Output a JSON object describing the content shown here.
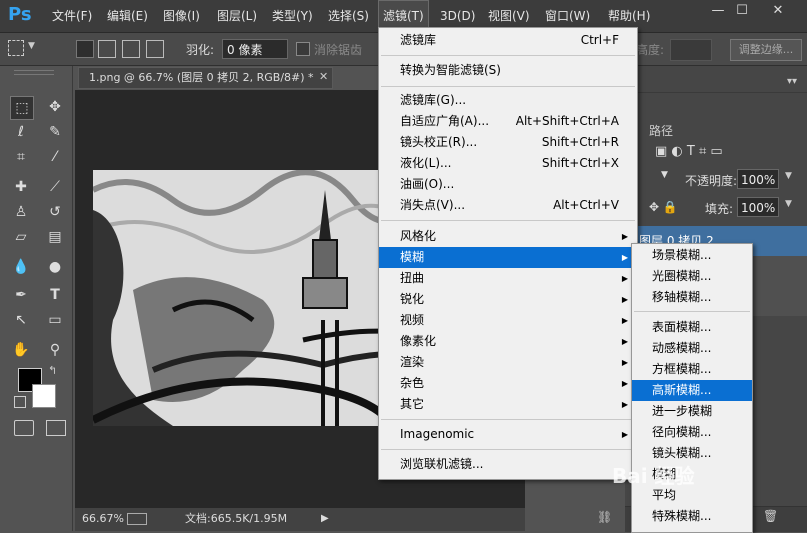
{
  "app": {
    "logo": "Ps"
  },
  "menubar": {
    "items": [
      "文件(F)",
      "编辑(E)",
      "图像(I)",
      "图层(L)",
      "类型(Y)",
      "选择(S)",
      "滤镜(T)",
      "3D(D)",
      "视图(V)",
      "窗口(W)",
      "帮助(H)"
    ]
  },
  "options": {
    "feather_label": "羽化:",
    "feather_value": "0 像素",
    "antialias_label": "消除锯齿",
    "height_label": "高度:",
    "refine_edge": "调整边缘..."
  },
  "document": {
    "tab_title": "1.png @ 66.7% (图层 0 拷贝 2, RGB/8#) *",
    "zoom": "66.67%",
    "doc_size": "文档:665.5K/1.95M"
  },
  "panels": {
    "paths_tab": "路径",
    "opacity_label": "不透明度:",
    "opacity_value": "100%",
    "fill_label": "填充:",
    "fill_value": "100%",
    "layer_name": "图层 0 拷贝 2"
  },
  "filter_menu": {
    "group1": [
      {
        "label": "滤镜库",
        "shortcut": "Ctrl+F"
      }
    ],
    "group2": [
      {
        "label": "转换为智能滤镜(S)"
      }
    ],
    "group3": [
      {
        "label": "滤镜库(G)...",
        "shortcut": ""
      },
      {
        "label": "自适应广角(A)...",
        "shortcut": "Alt+Shift+Ctrl+A"
      },
      {
        "label": "镜头校正(R)...",
        "shortcut": "Shift+Ctrl+R"
      },
      {
        "label": "液化(L)...",
        "shortcut": "Shift+Ctrl+X"
      },
      {
        "label": "油画(O)...",
        "shortcut": ""
      },
      {
        "label": "消失点(V)...",
        "shortcut": "Alt+Ctrl+V"
      }
    ],
    "group4": [
      "风格化",
      "模糊",
      "扭曲",
      "锐化",
      "视频",
      "像素化",
      "渲染",
      "杂色",
      "其它"
    ],
    "group5": [
      "Imagenomic"
    ],
    "group6": [
      "浏览联机滤镜..."
    ]
  },
  "blur_submenu": {
    "group1": [
      "场景模糊...",
      "光圈模糊...",
      "移轴模糊..."
    ],
    "group2": [
      "表面模糊...",
      "动感模糊...",
      "方框模糊...",
      "高斯模糊...",
      "进一步模糊",
      "径向模糊...",
      "镜头模糊...",
      "模糊",
      "平均",
      "特殊模糊..."
    ]
  },
  "watermark": "Bai 经验",
  "colors": {
    "highlight": "#0a6fd2",
    "menu_bg": "#f0f0f0",
    "app_bg": "#535353"
  }
}
